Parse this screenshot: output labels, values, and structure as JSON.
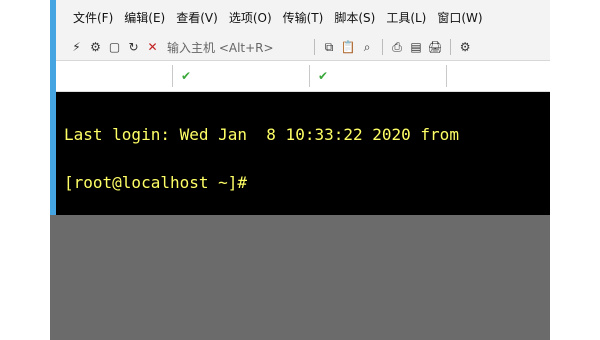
{
  "menu": {
    "items": [
      "文件(F)",
      "编辑(E)",
      "查看(V)",
      "选项(O)",
      "传输(T)",
      "脚本(S)",
      "工具(L)",
      "窗口(W)"
    ]
  },
  "toolbar": {
    "host_hint": "输入主机 <Alt+R>",
    "buttons": [
      {
        "icon": "connect-icon"
      },
      {
        "icon": "quick-connect-icon"
      },
      {
        "icon": "open-session-icon"
      },
      {
        "icon": "reconnect-icon"
      },
      {
        "icon": "disconnect-icon"
      },
      {
        "icon": "copy-icon"
      },
      {
        "icon": "paste-icon"
      },
      {
        "icon": "find-icon"
      },
      {
        "icon": "print-icon"
      },
      {
        "icon": "print-setup-icon"
      },
      {
        "icon": "log-icon"
      },
      {
        "icon": "settings-icon"
      }
    ]
  },
  "tabs": [
    {
      "status": "connected",
      "label": ""
    },
    {
      "status": "connected",
      "label": ""
    },
    {
      "status": "connected",
      "label": ""
    }
  ],
  "terminal": {
    "line1": "Last login: Wed Jan  8 10:33:22 2020 from",
    "line2": "[root@localhost ~]#"
  }
}
